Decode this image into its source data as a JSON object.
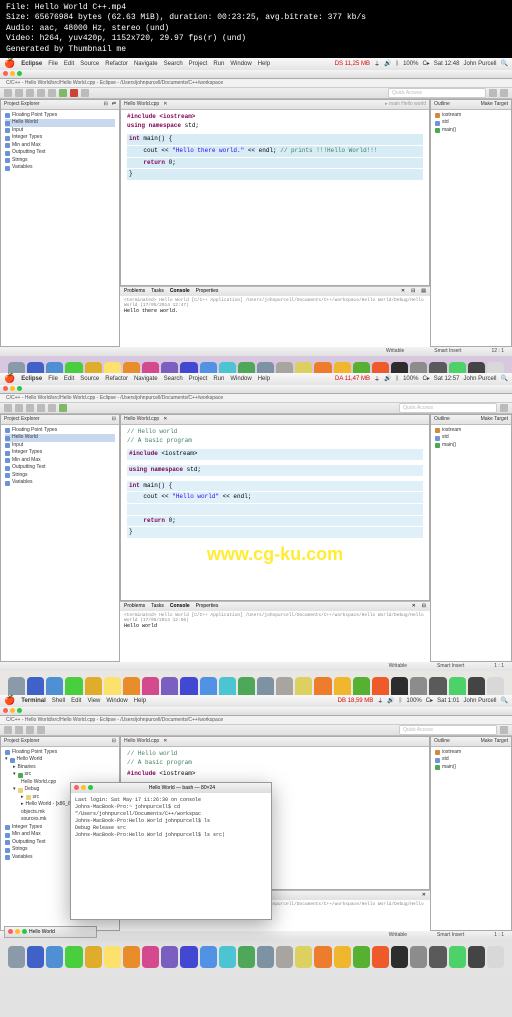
{
  "meta": {
    "file": "File: Hello World C++.mp4",
    "size": "Size: 65676984 bytes (62.63 MiB), duration: 00:23:25, avg.bitrate: 377 kb/s",
    "audio": "Audio: aac, 48000 Hz, stereo (und)",
    "video": "Video: h264, yuv420p, 1152x720, 29.97 fps(r) (und)",
    "gen": "Generated by Thumbnail me"
  },
  "menu": {
    "eclipse": "Eclipse",
    "file": "File",
    "edit": "Edit",
    "source": "Source",
    "refactor": "Refactor",
    "navigate": "Navigate",
    "search": "Search",
    "project": "Project",
    "run": "Run",
    "window": "Window",
    "help": "Help",
    "terminal": "Terminal",
    "shell": "Shell",
    "view": "View"
  },
  "status1": {
    "mem": "DS 11,25 MB",
    "wifi": "",
    "pct": "100%",
    "charge": "C▸",
    "time": "Sat 12:48",
    "user": "John Purcell"
  },
  "status2": {
    "mem": "DA 11,47 MB",
    "pct": "100%",
    "charge": "C▸",
    "time": "Sat 12:57",
    "user": "John Purcell"
  },
  "status3": {
    "mem": "DB 18,59 MB",
    "pct": "100%",
    "charge": "C▸",
    "time": "Sat 1:01",
    "user": "John Purcell"
  },
  "crumb": "C/C++ - Hello World/src/Hello World.cpp - Eclipse - /Users/johnpurcell/Documents/C++/workspace",
  "qa": "Quick Access",
  "views": {
    "project_explorer": "Project Explorer",
    "outline": "Outline",
    "make_target": "Make Target",
    "problems": "Problems",
    "tasks": "Tasks",
    "console": "Console",
    "properties": "Properties"
  },
  "tabs": {
    "hello_cpp": "Hello World.cpp",
    "main": "main",
    "hello_world": "Hello World"
  },
  "proj1": {
    "items": [
      "Floating Point Types",
      "Hello World",
      "Input",
      "Integer Types",
      "Min and Max",
      "Outputting Text",
      "Strings",
      "Variables"
    ]
  },
  "outline1": {
    "items": [
      "iostream",
      "std",
      "main()"
    ]
  },
  "code1": {
    "l1": "#include <iostream>",
    "l2": "using namespace std;",
    "l3": "int main() {",
    "l4": "    cout << \"Hello there world.\" << endl; // prints !!!Hello World!!!",
    "l5": "    return 0;",
    "l6": "}"
  },
  "code2": {
    "l0": "// Hello world",
    "l0b": "// A basic program",
    "l1": "#include <iostream>",
    "l2": "using namespace std;",
    "l3": "int main() {",
    "l4": "    cout << \"Hello world\" << endl;",
    "l5": "    return 0;",
    "l6": "}"
  },
  "watermark": "www.cg-ku.com",
  "console1": {
    "term": "<terminated> Hello World [C/C++ Application] /Users/johnpurcell/Documents/C++/workspace/Hello World/Debug/Hello World (17/05/2014 12:47)",
    "out": "Hello there world."
  },
  "console2": {
    "term": "<terminated> Hello World [C/C++ Application] /Users/johnpurcell/Documents/C++/workspace/Hello World/Debug/Hello World (17/05/2014 12:56)",
    "out": "Hello world"
  },
  "statusbar": {
    "writable": "Writable",
    "insert": "Smart Insert",
    "pos": "12 : 1",
    "pos2": "1 : 1"
  },
  "proj3": {
    "items": [
      "Hello World",
      "Binaries",
      "src",
      "Hello World.cpp",
      "Debug",
      "src",
      "Hello World - [x86_64/le]",
      "objects.mk",
      "sources.mk",
      "Integer Types",
      "Min and Max",
      "Outputting Text",
      "Strings",
      "Variables"
    ]
  },
  "terminal": {
    "title": "Hello World — bash — 80×24",
    "l1": "Last login: Sat May 17 11:26:30 on console",
    "l2": "Johns-MacBook-Pro:~ johnpurcell$ cd \"/Users/johnpurcell/Documents/C++/workspac",
    "l3": "Johns-MacBook-Pro:Hello World johnpurcell$ ls",
    "l4": "Debug   Release src",
    "l5": "Johns-MacBook-Pro:Hello World johnpurcell$ ls src|"
  },
  "minimized": "Hello World",
  "dock_colors": [
    "#8a9aa8",
    "#3f61c8",
    "#4f90d4",
    "#49cf3e",
    "#e0ac2c",
    "#fce26c",
    "#e88d2a",
    "#d34a8e",
    "#7a5fc0",
    "#4348d3",
    "#5292e5",
    "#4cc4d2",
    "#4fa85a",
    "#7d92a3",
    "#a8a4a0",
    "#dcd061",
    "#ed7d2c",
    "#f0b72e",
    "#56b032",
    "#ee5a2a",
    "#2d2d2d",
    "#8c8c8c",
    "#5a5a5a",
    "#4cd268",
    "#444",
    "#d8d8d8"
  ]
}
